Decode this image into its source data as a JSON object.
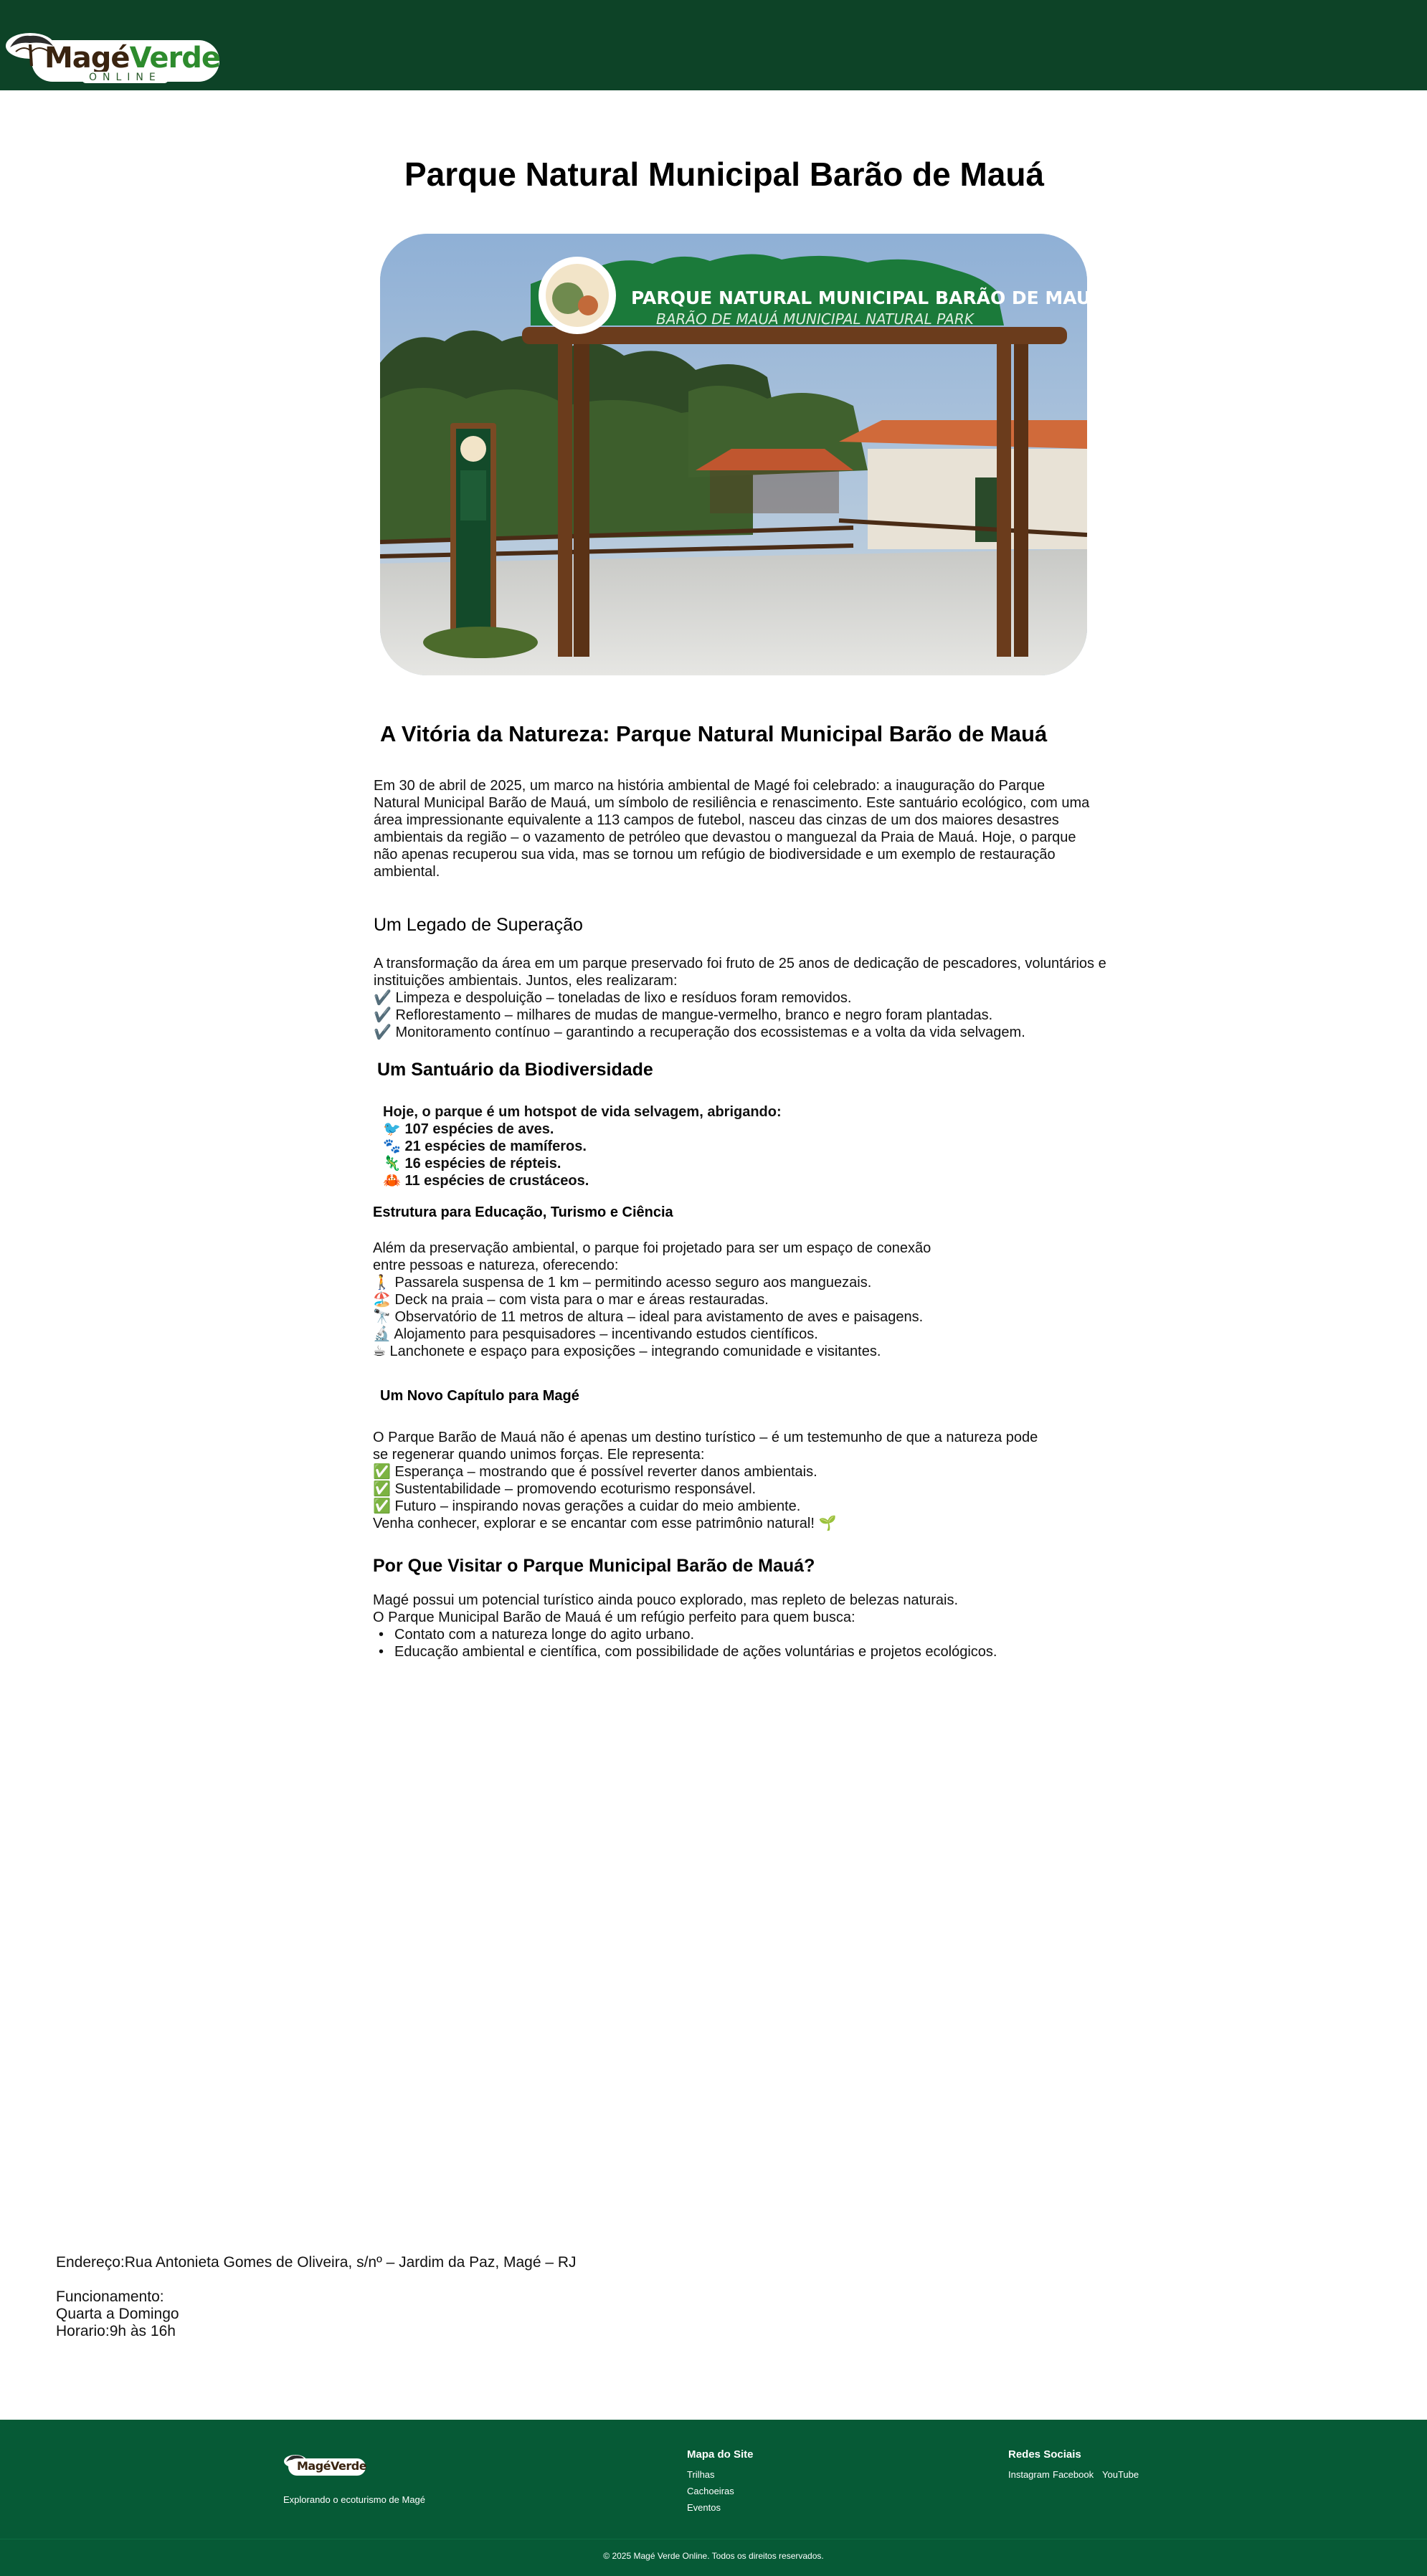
{
  "header": {
    "logo_mage": "Magé",
    "logo_verde": "Verde",
    "logo_online": "ONLINE"
  },
  "main": {
    "title": "Parque Natural Municipal Barão de Mauá",
    "hero_sign_title": "PARQUE NATURAL MUNICIPAL BARÃO DE MAUÁ",
    "hero_sign_subtitle": "BARÃO DE MAUÁ MUNICIPAL NATURAL PARK",
    "intro_title": "A Vitória da Natureza: Parque Natural Municipal Barão de Mauá",
    "intro_lines": [
      "Em 30 de abril de 2025, um marco na história ambiental de Magé foi celebrado: a inauguração do Parque",
      "Natural Municipal Barão de Mauá, um símbolo de resiliência e renascimento. Este santuário ecológico, com uma",
      "área impressionante equivalente a 113 campos de futebol, nasceu das cinzas de um dos maiores desastres",
      "ambientais da região – o vazamento de petróleo que devastou o manguezal da Praia de Mauá. Hoje, o parque",
      "não apenas recuperou sua vida, mas se tornou um refúgio de biodiversidade e um exemplo de restauração",
      "ambiental."
    ],
    "legado_title": "Um Legado de Superação",
    "legado_lines": [
      "A transformação da área em um parque preservado foi fruto de 25 anos de dedicação de pescadores, voluntários e",
      "instituições ambientais. Juntos, eles realizaram:",
      "✔️ Limpeza e despoluição – toneladas de lixo e resíduos foram removidos.",
      "✔️ Reflorestamento – milhares de mudas de mangue-vermelho, branco e negro foram plantadas.",
      "✔️ Monitoramento contínuo – garantindo a recuperação dos ecossistemas e a volta da vida selvagem."
    ],
    "santuario_title": "Um Santuário da Biodiversidade",
    "santuario_lines": [
      "Hoje, o parque é um hotspot de vida selvagem, abrigando:",
      "🐦 107 espécies de aves.",
      "🐾 21 espécies de mamíferos.",
      "🦎 16 espécies de répteis.",
      "🦀 11 espécies de crustáceos."
    ],
    "estrutura_title": "Estrutura para Educação, Turismo e Ciência",
    "estrutura_lines": [
      "Além da preservação ambiental, o parque foi projetado para ser um espaço de conexão",
      "entre pessoas e natureza, oferecendo:",
      "🚶 Passarela suspensa de 1 km – permitindo acesso seguro aos manguezais.",
      "🏖️ Deck na praia – com vista para o mar e áreas restauradas.",
      "🔭 Observatório de 11 metros de altura – ideal para avistamento de aves e paisagens.",
      "🔬 Alojamento para pesquisadores – incentivando estudos científicos.",
      "☕ Lanchonete e espaço para exposições – integrando comunidade e visitantes."
    ],
    "capitulo_title": "Um Novo Capítulo para Magé",
    "capitulo_lines": [
      "O Parque Barão de Mauá não é apenas um destino turístico – é um testemunho de que a natureza pode",
      "se regenerar quando unimos forças. Ele representa:",
      "✅ Esperança – mostrando que é possível reverter danos ambientais.",
      "✅ Sustentabilidade – promovendo ecoturismo responsável.",
      "✅ Futuro – inspirando novas gerações a cuidar do meio ambiente.",
      "Venha conhecer, explorar e se encantar com esse patrimônio natural! 🌱"
    ],
    "visitar_title": "Por Que Visitar o Parque Municipal Barão de Mauá?",
    "visitar_lines": [
      "Magé possui um potencial turístico ainda pouco explorado, mas repleto de belezas naturais.",
      "O Parque Municipal Barão de Mauá é um refúgio perfeito para quem busca:"
    ],
    "visitar_items": [
      "Contato com a natureza longe do agito urbano.",
      "Educação ambiental e científica, com possibilidade de ações voluntárias e projetos ecológicos."
    ]
  },
  "info": {
    "address": "Endereço:Rua Antonieta Gomes de Oliveira, s/nº – Jardim da Paz, Magé – RJ",
    "hours_label": "Funcionamento:",
    "days": "Quarta a Domingo",
    "hours": "Horario:9h às 16h"
  },
  "footer": {
    "logo_text": "MagéVerde",
    "tagline": "Explorando o ecoturismo de Magé",
    "sitemap_title": "Mapa do Site",
    "sitemap_links": [
      "Trilhas",
      "Cachoeiras",
      "Eventos"
    ],
    "social_title": "Redes Sociais",
    "social_links": [
      "Instagram",
      "Facebook",
      "YouTube"
    ],
    "copyright": "© 2025 Magé Verde Online. Todos os direitos reservados."
  },
  "colors": {
    "header_bg": "#0d4327",
    "footer_bg": "#065a36",
    "sign_green": "#1b7a3a"
  }
}
